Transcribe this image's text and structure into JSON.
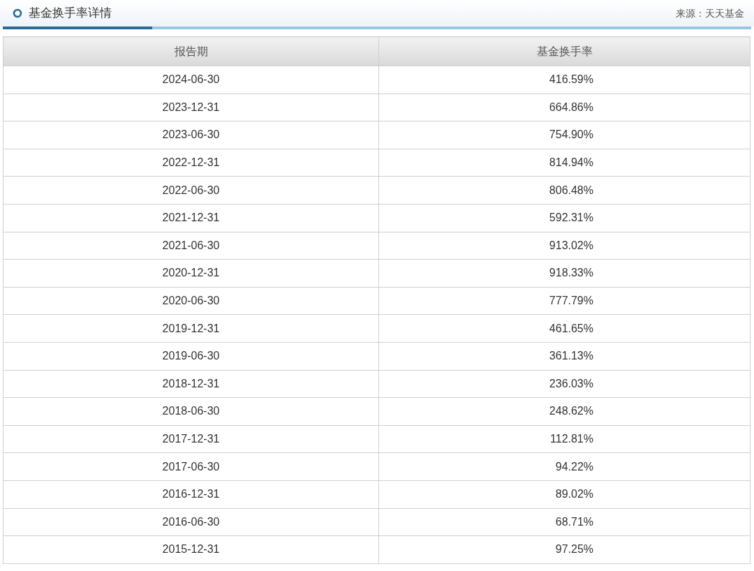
{
  "panel": {
    "title": "基金换手率详情",
    "source": "来源：天天基金"
  },
  "table": {
    "columns": [
      "报告期",
      "基金换手率"
    ],
    "rows": [
      [
        "2024-06-30",
        "416.59%"
      ],
      [
        "2023-12-31",
        "664.86%"
      ],
      [
        "2023-06-30",
        "754.90%"
      ],
      [
        "2022-12-31",
        "814.94%"
      ],
      [
        "2022-06-30",
        "806.48%"
      ],
      [
        "2021-12-31",
        "592.31%"
      ],
      [
        "2021-06-30",
        "913.02%"
      ],
      [
        "2020-12-31",
        "918.33%"
      ],
      [
        "2020-06-30",
        "777.79%"
      ],
      [
        "2019-12-31",
        "461.65%"
      ],
      [
        "2019-06-30",
        "361.13%"
      ],
      [
        "2018-12-31",
        "236.03%"
      ],
      [
        "2018-06-30",
        "248.62%"
      ],
      [
        "2017-12-31",
        "112.81%"
      ],
      [
        "2017-06-30",
        "94.22%"
      ],
      [
        "2016-12-31",
        "89.02%"
      ],
      [
        "2016-06-30",
        "68.71%"
      ],
      [
        "2015-12-31",
        "97.25%"
      ]
    ]
  }
}
